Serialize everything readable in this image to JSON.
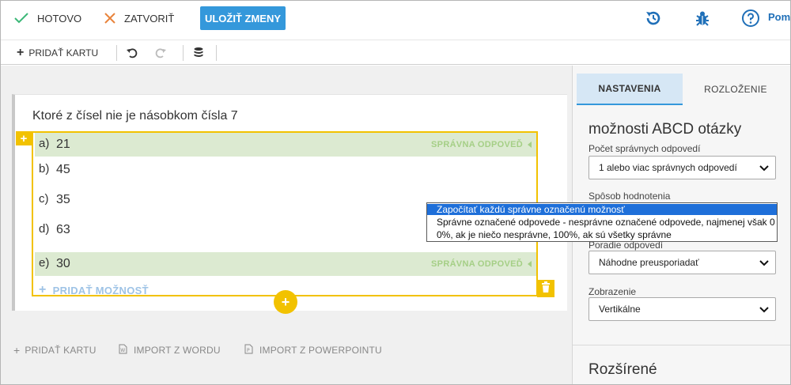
{
  "topbar": {
    "done_label": "HOTOVO",
    "close_label": "ZATVORIŤ",
    "save_label": "ULOŽIŤ ZMENY",
    "help_label": "Pom",
    "colors": {
      "save_bg": "#3498db",
      "done_check": "#3cb878",
      "close_x": "#e8843c",
      "icon_blue": "#1f6fb8"
    }
  },
  "toolbar": {
    "add_card_label": "PRIDAŤ KARTU"
  },
  "card": {
    "question": "Ktoré z čísel nie je násobkom čísla 7",
    "correct_label": "SPRÁVNA ODPOVEĎ",
    "options": [
      {
        "letter": "a)",
        "value": "21",
        "correct": true
      },
      {
        "letter": "b)",
        "value": "45",
        "correct": false
      },
      {
        "letter": "c)",
        "value": "35",
        "correct": false
      },
      {
        "letter": "d)",
        "value": "63",
        "correct": false
      },
      {
        "letter": "e)",
        "value": "30",
        "correct": true
      }
    ],
    "add_option_label": "PRIDAŤ MOŽNOSŤ",
    "accent_color": "#f2c200",
    "correct_bg": "#dcead1"
  },
  "bottom": {
    "add_card_label": "PRIDAŤ KARTU",
    "import_word_label": "IMPORT Z WORDU",
    "import_ppt_label": "IMPORT Z POWERPOINTU"
  },
  "panel": {
    "tab_settings": "NASTAVENIA",
    "tab_layout": "ROZLOŽENIE",
    "title": "možnosti ABCD otázky",
    "correct_count_label": "Počet správnych odpovedí",
    "correct_count_value": "1 alebo viac správnych odpovedí",
    "grading_label": "Spôsob hodnotenia",
    "order_label": "Poradie odpovedí",
    "order_value": "Náhodne preusporiadať",
    "display_label": "Zobrazenie",
    "display_value": "Vertikálne",
    "advanced_title": "Rozšírené"
  },
  "grading_dropdown": {
    "options": [
      "Započítať každú správne označenú možnosť",
      "Správne označené odpovede - nesprávne označené odpovede, najmenej však 0",
      "0%, ak je niečo nesprávne, 100%, ak sú všetky správne"
    ],
    "selected_index": 0
  }
}
